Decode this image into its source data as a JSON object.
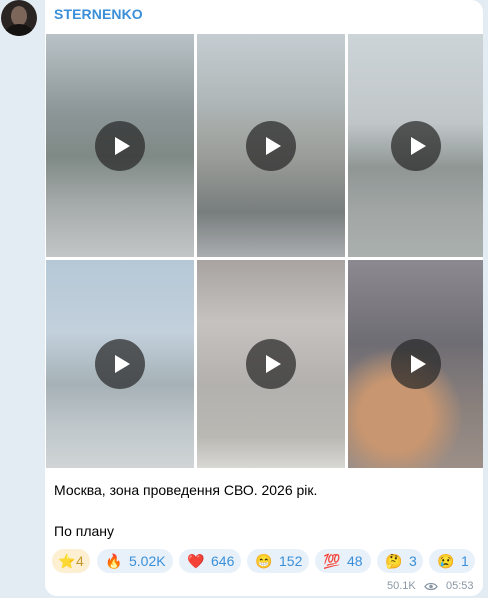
{
  "channel": {
    "name": "STERNENKO"
  },
  "avatar": {
    "description": "channel-avatar"
  },
  "media": {
    "videos": [
      {
        "icon": "play-icon"
      },
      {
        "icon": "play-icon"
      },
      {
        "icon": "play-icon"
      },
      {
        "icon": "play-icon"
      },
      {
        "icon": "play-icon"
      },
      {
        "icon": "play-icon"
      }
    ]
  },
  "message": {
    "line1": "Москва, зона проведення СВО. 2026 рік.",
    "line2": "По плану"
  },
  "reactions": [
    {
      "emoji": "⭐",
      "count": "4",
      "name": "star"
    },
    {
      "emoji": "🔥",
      "count": "5.02K",
      "name": "fire"
    },
    {
      "emoji": "❤️",
      "count": "646",
      "name": "heart"
    },
    {
      "emoji": "😁",
      "count": "152",
      "name": "grin"
    },
    {
      "emoji": "💯",
      "count": "48",
      "name": "hundred"
    },
    {
      "emoji": "🤔",
      "count": "3",
      "name": "thinking"
    },
    {
      "emoji": "😢",
      "count": "1",
      "name": "crying"
    }
  ],
  "footer": {
    "views": "50.1K",
    "time": "05:53"
  },
  "colors": {
    "accent": "#3a8fd8",
    "background": "#e4ecf3",
    "reaction_bg": "#e8f1fa"
  }
}
